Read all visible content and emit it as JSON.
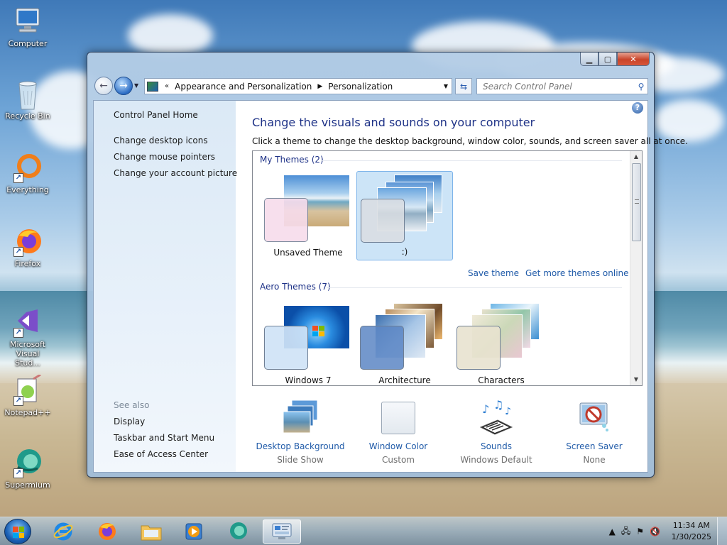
{
  "desktop": {
    "icons": [
      {
        "label": "Computer",
        "icon": "computer-icon"
      },
      {
        "label": "Recycle Bin",
        "icon": "recycle-bin-icon"
      },
      {
        "label": "Everything",
        "icon": "everything-icon"
      },
      {
        "label": "Firefox",
        "icon": "firefox-icon"
      },
      {
        "label": "Microsoft Visual Stud...",
        "icon": "visual-studio-icon"
      },
      {
        "label": "Notepad++",
        "icon": "notepad-plus-icon"
      },
      {
        "label": "Supermium",
        "icon": "supermium-icon"
      }
    ]
  },
  "window": {
    "breadcrumb": {
      "root_chevron": "«",
      "item1": "Appearance and Personalization",
      "item2": "Personalization"
    },
    "search_placeholder": "Search Control Panel",
    "left_nav": {
      "home": "Control Panel Home",
      "links": [
        "Change desktop icons",
        "Change mouse pointers",
        "Change your account picture"
      ],
      "see_also_header": "See also",
      "see_also": [
        "Display",
        "Taskbar and Start Menu",
        "Ease of Access Center"
      ]
    },
    "main": {
      "title": "Change the visuals and sounds on your computer",
      "subtitle": "Click a theme to change the desktop background, window color, sounds, and screen saver all at once.",
      "my_themes_header": "My Themes (2)",
      "my_themes": [
        {
          "label": "Unsaved Theme",
          "selected": false,
          "swatch_color": "#f7dcec"
        },
        {
          "label": ":)",
          "selected": true,
          "swatch_color": "#d9dde2"
        }
      ],
      "save_theme": "Save theme",
      "get_more": "Get more themes online",
      "aero_header": "Aero Themes (7)",
      "aero_themes": [
        {
          "label": "Windows 7",
          "swatch_color": "#cfe3f6"
        },
        {
          "label": "Architecture",
          "swatch_color": "#5c86c4"
        },
        {
          "label": "Characters",
          "swatch_color": "#e8e2cf"
        }
      ],
      "bottom": [
        {
          "label": "Desktop Background",
          "sub": "Slide Show",
          "icon": "desktop-background-icon"
        },
        {
          "label": "Window Color",
          "sub": "Custom",
          "icon": "window-color-icon"
        },
        {
          "label": "Sounds",
          "sub": "Windows Default",
          "icon": "sounds-icon"
        },
        {
          "label": "Screen Saver",
          "sub": "None",
          "icon": "screen-saver-icon"
        }
      ]
    }
  },
  "taskbar": {
    "apps": [
      "internet-explorer-icon",
      "firefox-icon",
      "file-explorer-icon",
      "media-player-icon",
      "supermium-icon",
      "control-panel-icon"
    ],
    "time": "11:34 AM",
    "date": "1/30/2025"
  },
  "colors": {
    "link": "#1f5aa8",
    "title": "#1e3287",
    "selection": "#cce4f7"
  }
}
